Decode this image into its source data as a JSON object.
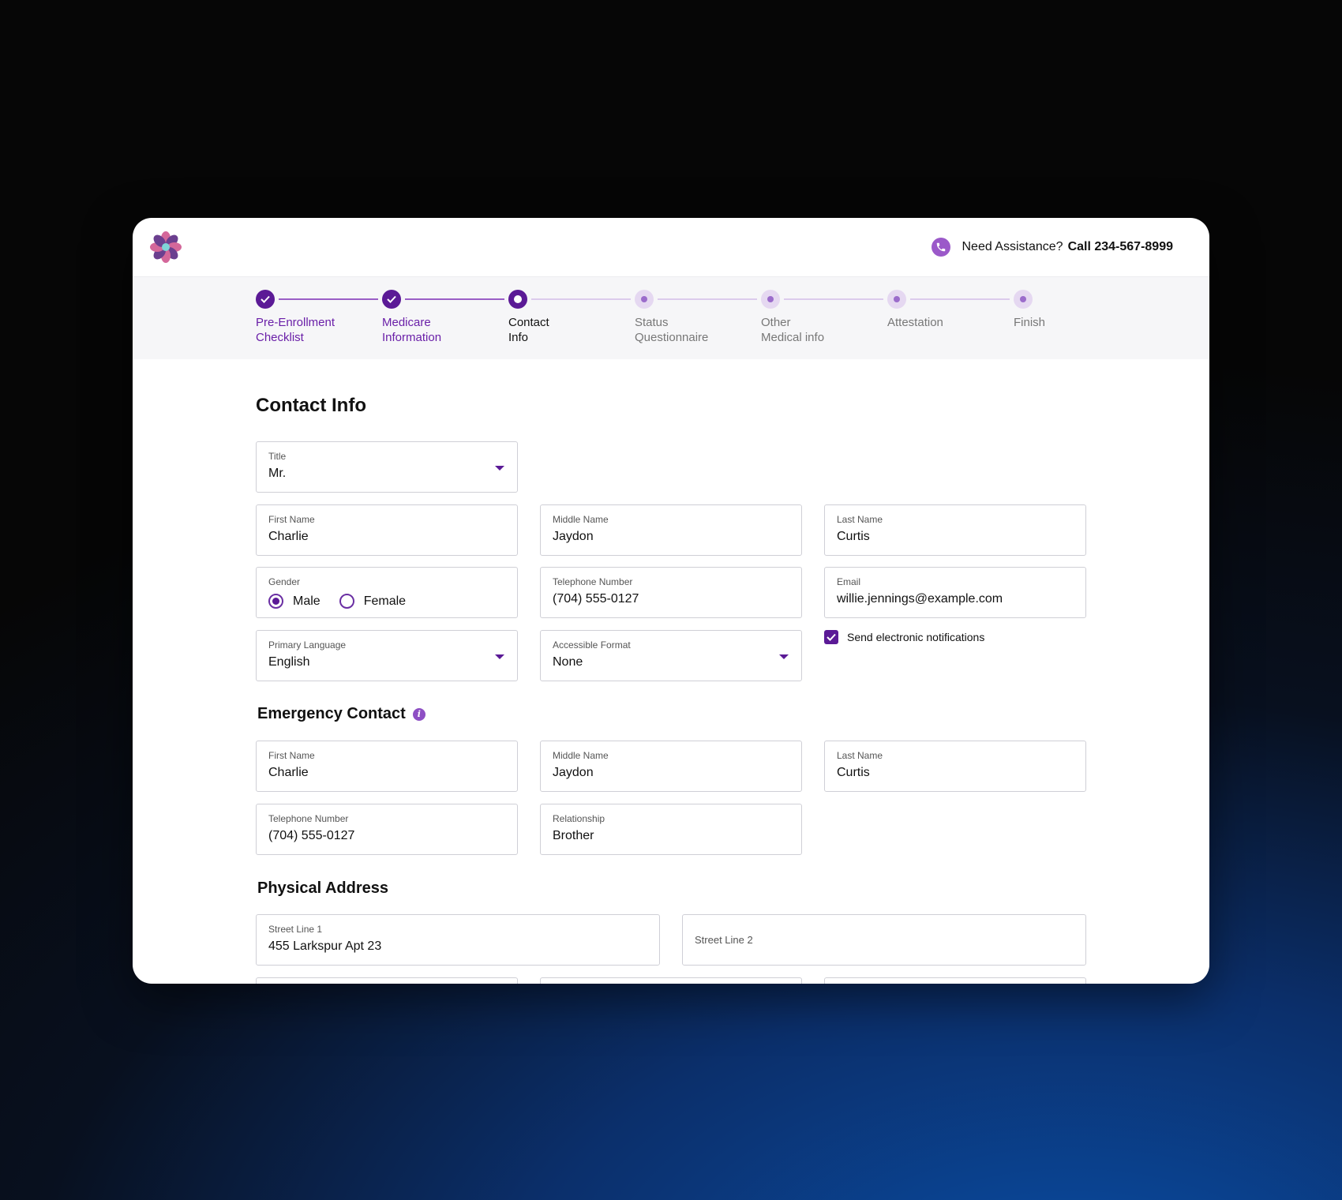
{
  "header": {
    "assist_text": "Need Assistance?",
    "assist_phone": "Call 234-567-8999"
  },
  "stepper": {
    "steps": [
      {
        "label": "Pre-Enrollment\nChecklist",
        "state": "done"
      },
      {
        "label": "Medicare\nInformation",
        "state": "done"
      },
      {
        "label": "Contact\nInfo",
        "state": "current"
      },
      {
        "label": "Status\nQuestionnaire",
        "state": "todo"
      },
      {
        "label": "Other\nMedical info",
        "state": "todo"
      },
      {
        "label": "Attestation",
        "state": "todo"
      },
      {
        "label": "Finish",
        "state": "todo"
      }
    ]
  },
  "contact": {
    "heading": "Contact Info",
    "title": {
      "label": "Title",
      "value": "Mr."
    },
    "first_name": {
      "label": "First Name",
      "value": "Charlie"
    },
    "middle_name": {
      "label": "Middle Name",
      "value": "Jaydon"
    },
    "last_name": {
      "label": "Last Name",
      "value": "Curtis"
    },
    "gender": {
      "label": "Gender",
      "options": [
        "Male",
        "Female"
      ],
      "selected": "Male"
    },
    "telephone": {
      "label": "Telephone Number",
      "value": "(704) 555-0127"
    },
    "email": {
      "label": "Email",
      "value": "willie.jennings@example.com"
    },
    "primary_language": {
      "label": "Primary Language",
      "value": "English"
    },
    "accessible_format": {
      "label": "Accessible Format",
      "value": "None"
    },
    "notifications": {
      "label": "Send electronic notifications",
      "checked": true
    }
  },
  "emergency": {
    "heading": "Emergency Contact",
    "first_name": {
      "label": "First Name",
      "value": "Charlie"
    },
    "middle_name": {
      "label": "Middle Name",
      "value": "Jaydon"
    },
    "last_name": {
      "label": "Last Name",
      "value": "Curtis"
    },
    "telephone": {
      "label": "Telephone Number",
      "value": "(704) 555-0127"
    },
    "relationship": {
      "label": "Relationship",
      "value": "Brother"
    }
  },
  "address": {
    "heading": "Physical Address",
    "street1": {
      "label": "Street Line 1",
      "value": "455 Larkspur Apt 23"
    },
    "street2": {
      "label": "Street Line 2"
    }
  },
  "colors": {
    "accent": "#5b1a96",
    "accent_light": "#9b59c9",
    "step_todo": "#e5d8f1"
  }
}
